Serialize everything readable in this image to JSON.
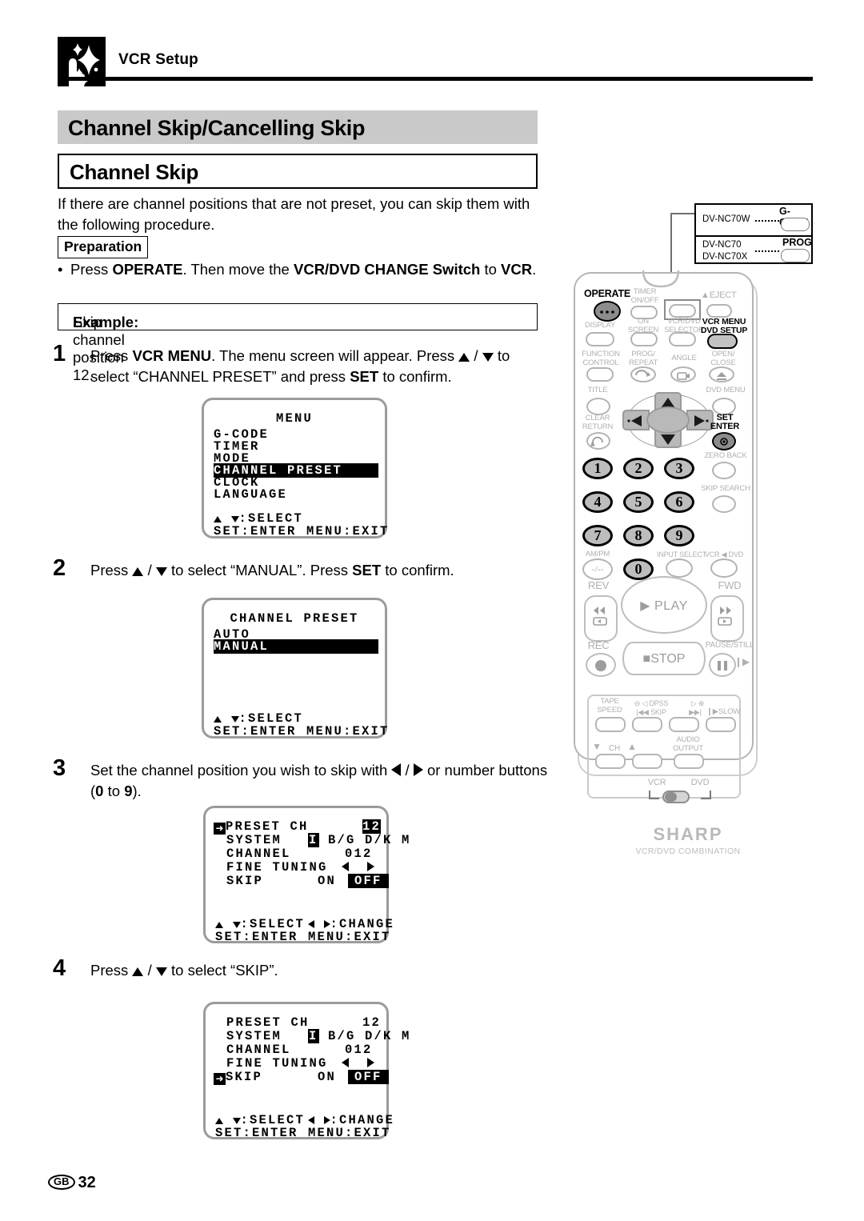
{
  "header": {
    "icon": "vcr-setup-icon",
    "title": "VCR Setup"
  },
  "section": {
    "title": "Channel Skip/Cancelling Skip",
    "subtitle": "Channel Skip"
  },
  "intro": "If there are channel positions that are not preset, you can skip them with the following procedure.",
  "preparation": {
    "label": "Preparation",
    "bullet": "•",
    "text_1": "Press ",
    "bold_1": "OPERATE",
    "text_2": ". Then move the ",
    "bold_2": "VCR/DVD CHANGE Switch",
    "text_3": " to ",
    "bold_3": "VCR",
    "text_4": "."
  },
  "example": {
    "label": "Example:",
    "text": " Skip channel position 12."
  },
  "steps": [
    {
      "num": "1",
      "pre": "Press ",
      "bold_1": "VCR MENU",
      "mid_1": ". The menu screen will appear. Press ",
      "mid_2": " to select “CHANNEL PRESET” and press ",
      "bold_2": "SET",
      "tail": " to confirm."
    },
    {
      "num": "2",
      "pre": "Press ",
      "mid_1": " to select “MANUAL”. Press ",
      "bold_1": "SET",
      "tail": " to confirm."
    },
    {
      "num": "3",
      "pre": "Set the channel position you wish to skip with ",
      "mid_1": " or number buttons (",
      "bold_1": "0",
      "mid_2": " to ",
      "bold_2": "9",
      "tail": ")."
    },
    {
      "num": "4",
      "pre": "Press ",
      "mid_1": " to select “SKIP”.",
      "tail": ""
    }
  ],
  "osd_screens": [
    {
      "name": "menu-screen",
      "title": "MENU",
      "items": [
        {
          "label": "G-CODE",
          "highlighted": false
        },
        {
          "label": "TIMER",
          "highlighted": false
        },
        {
          "label": "MODE",
          "highlighted": false
        },
        {
          "label": "CHANNEL PRESET",
          "highlighted": true
        },
        {
          "label": "CLOCK",
          "highlighted": false
        },
        {
          "label": "LANGUAGE",
          "highlighted": false
        }
      ],
      "hint_select": ":SELECT",
      "hint_enter": "SET:ENTER",
      "hint_exit": "MENU:EXIT"
    },
    {
      "name": "channel-preset-screen",
      "title": "CHANNEL PRESET",
      "items": [
        {
          "label": "AUTO",
          "highlighted": false
        },
        {
          "label": "MANUAL",
          "highlighted": true
        }
      ],
      "hint_select": ":SELECT",
      "hint_enter": "SET:ENTER",
      "hint_exit": "MENU:EXIT"
    },
    {
      "name": "preset-ch-screen-step3",
      "cursor_row": "PRESET CH",
      "rows": [
        {
          "label": "PRESET CH",
          "value": "12",
          "value_highlighted": true
        },
        {
          "label": "SYSTEM",
          "value": "I B/G D/K M",
          "chip": "I"
        },
        {
          "label": "CHANNEL",
          "value": "012"
        },
        {
          "label": "FINE TUNING",
          "value": "◀  ▶"
        },
        {
          "label": "SKIP",
          "value_on": "ON",
          "value_off": "OFF",
          "off_highlighted": true
        }
      ],
      "hint_select": ":SELECT",
      "hint_change": ":CHANGE",
      "hint_enter": "SET:ENTER",
      "hint_exit": "MENU:EXIT"
    },
    {
      "name": "preset-ch-screen-step4",
      "cursor_row": "SKIP",
      "rows": [
        {
          "label": "PRESET CH",
          "value": "12"
        },
        {
          "label": "SYSTEM",
          "value": "I B/G D/K M",
          "chip": "I"
        },
        {
          "label": "CHANNEL",
          "value": "012"
        },
        {
          "label": "FINE TUNING",
          "value": "◀  ▶"
        },
        {
          "label": "SKIP",
          "value_on": "ON",
          "value_off": "OFF",
          "off_highlighted": true
        }
      ],
      "hint_select": ":SELECT",
      "hint_change": ":CHANGE",
      "hint_enter": "SET:ENTER",
      "hint_exit": "MENU:EXIT"
    }
  ],
  "remote": {
    "model_box": {
      "row1_model": "DV-NC70W",
      "row1_button": "G-CODE",
      "row2_model_a": "DV-NC70",
      "row2_model_b": "DV-NC70X",
      "row2_button": "PROG"
    },
    "buttons": {
      "operate": "OPERATE",
      "timer_onoff": "TIMER\nON/OFF",
      "eject": "EJECT",
      "display": "DISPLAY",
      "on_screen": "ON\nSCREEN",
      "vcr_dvd_selector": "VCR/DVD\nSELECTOR",
      "vcr_menu_dvd_setup": "VCR MENU\nDVD SETUP",
      "function_control": "FUNCTION\nCONTROL",
      "prog_repeat": "PROG/\nREPEAT",
      "angle": "ANGLE",
      "open_close": "OPEN/\nCLOSE",
      "title": "TITLE",
      "dvd_menu": "DVD MENU",
      "clear_return": "CLEAR\nRETURN",
      "set_enter": "SET\nENTER",
      "zero_back": "ZERO BACK",
      "skip_search": "SKIP SEARCH",
      "am_pm": "AM/PM",
      "am_pm_glyph": "-/--",
      "input_select": "INPUT SELECT",
      "vcr_dvd": "VCR ◀ DVD",
      "rev": "REV",
      "fwd": "FWD",
      "play": "PLAY",
      "rec": "REC",
      "stop": "STOP",
      "pause_still": "PAUSE/STILL",
      "tape_speed": "TAPE\nSPEED",
      "dpss": "DPSS",
      "skip": "SKIP",
      "slow": "SLOW",
      "ch": "CH",
      "audio_output": "AUDIO\nOUTPUT",
      "switch_vcr": "VCR",
      "switch_dvd": "DVD"
    },
    "numbers": [
      "1",
      "2",
      "3",
      "4",
      "5",
      "6",
      "7",
      "8",
      "9",
      "0"
    ],
    "brand": "SHARP",
    "brand_sub": "VCR/DVD COMBINATION"
  },
  "footer": {
    "region": "GB",
    "page": "32"
  },
  "colors": {
    "section_bar_bg": "#c9c9c9",
    "osd_highlight_bg": "#000000",
    "osd_highlight_fg": "#ffffff",
    "remote_outline": "#b5b5b5"
  }
}
